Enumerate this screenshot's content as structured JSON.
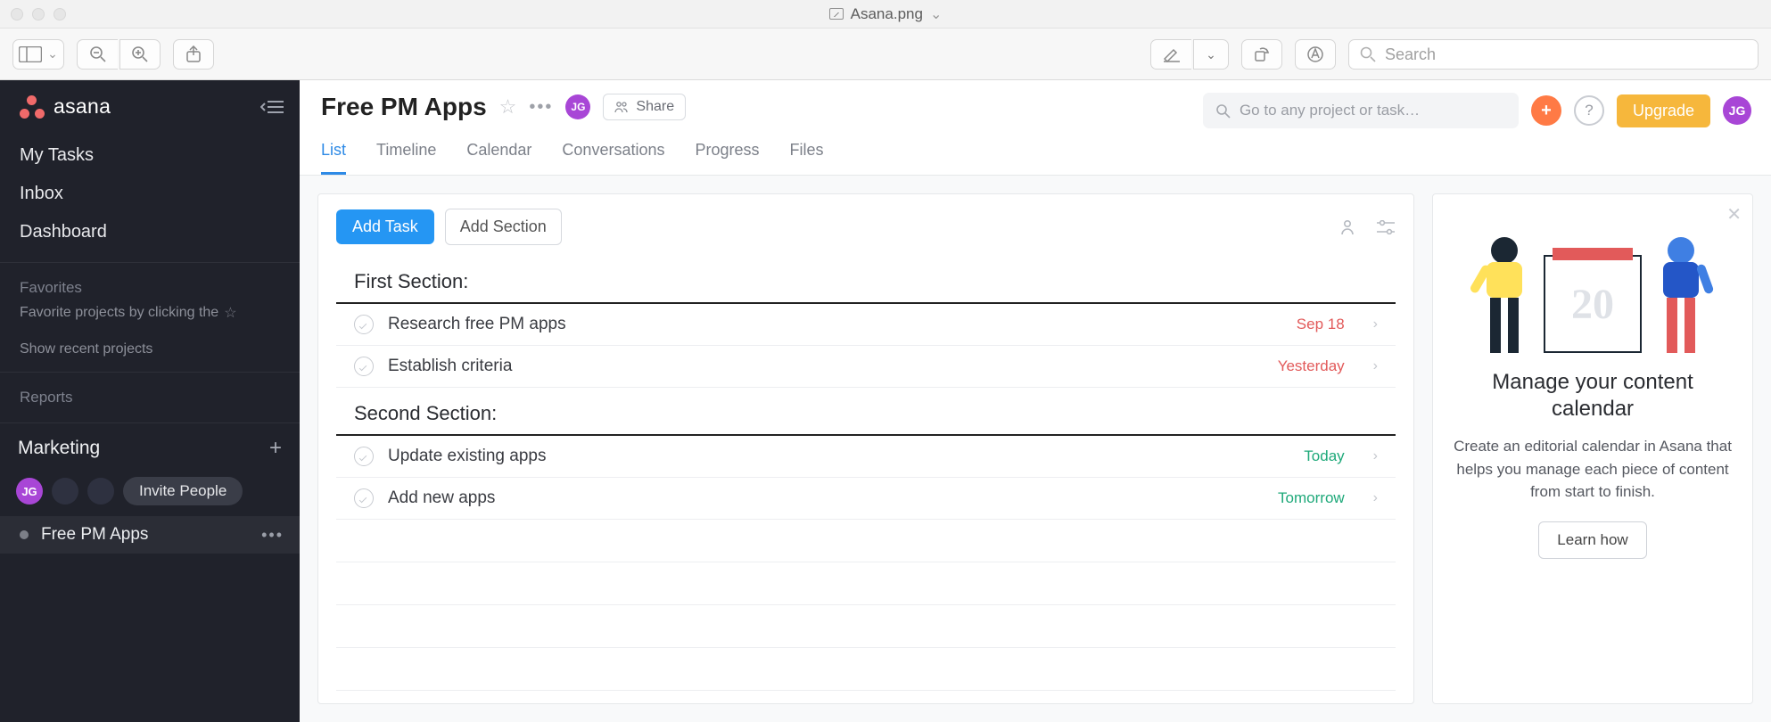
{
  "window": {
    "filename": "Asana.png"
  },
  "mac_toolbar": {
    "search_placeholder": "Search"
  },
  "sidebar": {
    "brand": "asana",
    "nav": [
      {
        "label": "My Tasks"
      },
      {
        "label": "Inbox"
      },
      {
        "label": "Dashboard"
      }
    ],
    "favorites_label": "Favorites",
    "favorites_hint": "Favorite projects by clicking the",
    "recent_hint": "Show recent projects",
    "reports_label": "Reports",
    "team_name": "Marketing",
    "member_initials": "JG",
    "invite_label": "Invite People",
    "projects": [
      {
        "name": "Free PM Apps"
      }
    ]
  },
  "header": {
    "project_title": "Free PM Apps",
    "share_label": "Share",
    "search_placeholder": "Go to any project or task…",
    "upgrade_label": "Upgrade",
    "avatar_initials": "JG",
    "tabs": [
      {
        "label": "List",
        "active": true
      },
      {
        "label": "Timeline"
      },
      {
        "label": "Calendar"
      },
      {
        "label": "Conversations"
      },
      {
        "label": "Progress"
      },
      {
        "label": "Files"
      }
    ]
  },
  "task_toolbar": {
    "add_task_label": "Add Task",
    "add_section_label": "Add Section"
  },
  "sections": [
    {
      "title": "First Section:",
      "tasks": [
        {
          "name": "Research free PM apps",
          "date": "Sep 18",
          "date_color": "red"
        },
        {
          "name": "Establish criteria",
          "date": "Yesterday",
          "date_color": "red"
        }
      ]
    },
    {
      "title": "Second Section:",
      "tasks": [
        {
          "name": "Update existing apps",
          "date": "Today",
          "date_color": "green"
        },
        {
          "name": "Add new apps",
          "date": "Tomorrow",
          "date_color": "green"
        }
      ]
    }
  ],
  "promo": {
    "calendar_number": "20",
    "title": "Manage your content calendar",
    "text": "Create an editorial calendar in Asana that helps you manage each piece of content from start to finish.",
    "cta": "Learn how"
  }
}
